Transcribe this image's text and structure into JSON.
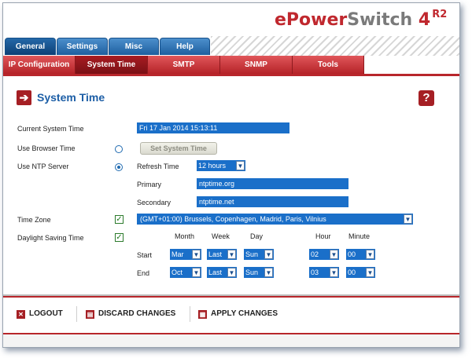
{
  "brand": {
    "part1": "ePower",
    "part2": "Switch",
    "version": "4",
    "suffix": "R2"
  },
  "colors": {
    "tab_blue": "#1e5f9f",
    "tab_red": "#b52328",
    "field_blue": "#1a6fc9",
    "accent_red": "#a51f24",
    "title_blue": "#1c5ea6"
  },
  "main_tabs": [
    {
      "label": "General",
      "active": true
    },
    {
      "label": "Settings",
      "active": false
    },
    {
      "label": "Misc",
      "active": false
    },
    {
      "label": "Help",
      "active": false
    }
  ],
  "sub_tabs": [
    {
      "label": "IP Configuration",
      "active": false
    },
    {
      "label": "System Time",
      "active": true
    },
    {
      "label": "SMTP",
      "active": false
    },
    {
      "label": "SNMP",
      "active": false
    },
    {
      "label": "Tools",
      "active": false
    }
  ],
  "page": {
    "title": "System Time",
    "icon": "arrow-right-icon",
    "help_glyph": "?"
  },
  "form": {
    "current_time_label": "Current System Time",
    "current_time_value": "Fri 17 Jan 2014 15:13:11",
    "browser_label": "Use Browser Time",
    "browser_selected": false,
    "set_button": "Set System Time",
    "ntp_label": "Use NTP Server",
    "ntp_selected": true,
    "refresh_label": "Refresh Time",
    "refresh_value": "12 hours",
    "primary_label": "Primary",
    "primary_value": "ntptime.org",
    "secondary_label": "Secondary",
    "secondary_value": "ntptime.net",
    "timezone_label": "Time Zone",
    "timezone_checked": true,
    "timezone_value": "(GMT+01:00) Brussels, Copenhagen, Madrid, Paris, Vilnius",
    "dst_label": "Daylight Saving Time",
    "dst_checked": true,
    "check_glyph": "✓",
    "dst_headers": {
      "month": "Month",
      "week": "Week",
      "day": "Day",
      "hour": "Hour",
      "minute": "Minute"
    },
    "start": {
      "label": "Start",
      "month": "Mar",
      "week": "Last",
      "day": "Sun",
      "hour": "02",
      "minute": "00"
    },
    "end": {
      "label": "End",
      "month": "Oct",
      "week": "Last",
      "day": "Sun",
      "hour": "03",
      "minute": "00"
    }
  },
  "footer": {
    "logout": "LOGOUT",
    "discard": "DISCARD CHANGES",
    "apply": "APPLY CHANGES"
  }
}
